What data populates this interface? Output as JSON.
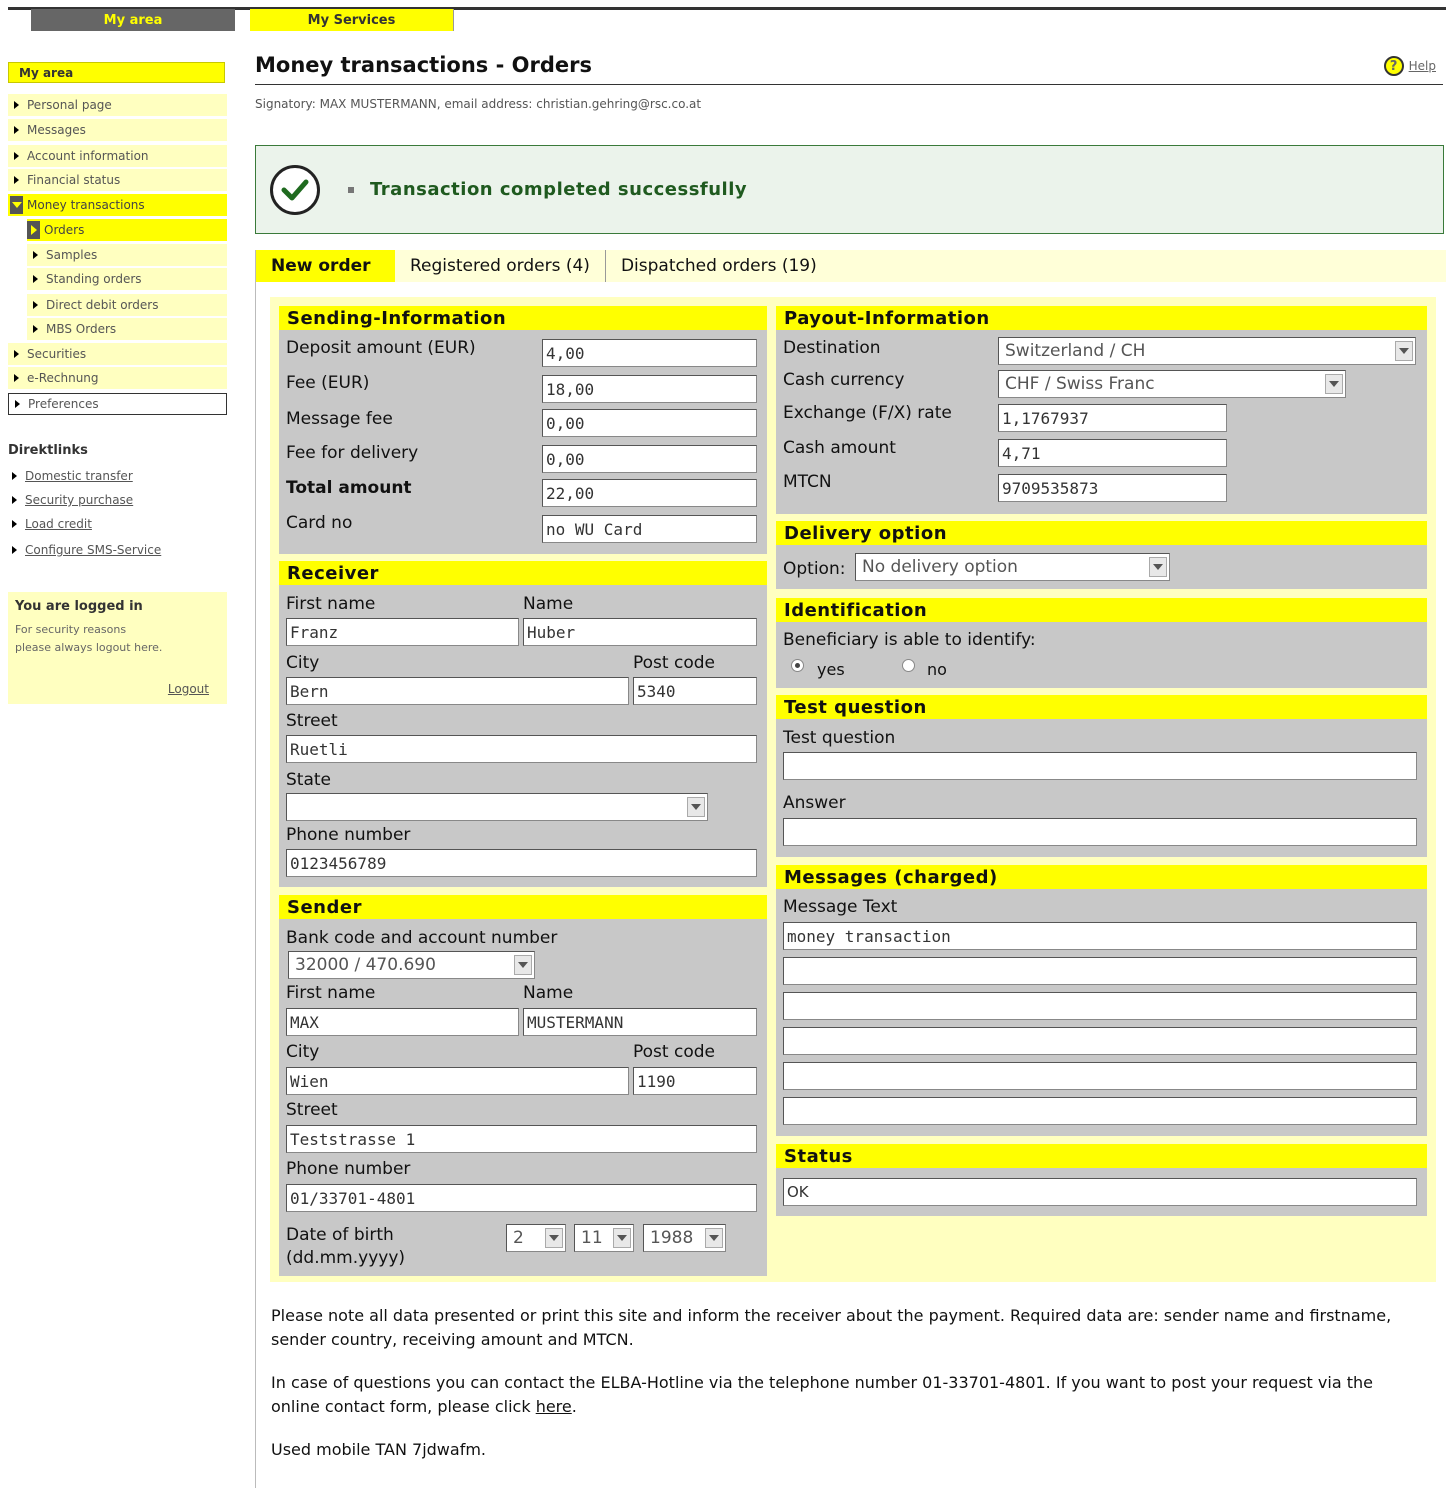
{
  "top_tabs": {
    "my_area": "My area",
    "my_services": "My Services"
  },
  "sidebar": {
    "header": "My area",
    "items": [
      {
        "label": "Personal page"
      },
      {
        "label": "Messages"
      },
      {
        "label": "Account information"
      },
      {
        "label": "Financial status"
      },
      {
        "label": "Money transactions"
      },
      {
        "label": "Orders"
      },
      {
        "label": "Samples"
      },
      {
        "label": "Standing orders"
      },
      {
        "label": "Direct debit orders"
      },
      {
        "label": "MBS Orders"
      },
      {
        "label": "Securities"
      },
      {
        "label": "e-Rechnung"
      },
      {
        "label": "Preferences"
      }
    ],
    "direktlinks_title": "Direktlinks",
    "direktlinks": [
      {
        "label": "Domestic transfer"
      },
      {
        "label": "Security purchase"
      },
      {
        "label": "Load credit"
      },
      {
        "label": "Configure SMS-Service"
      }
    ],
    "logged_title": "You are logged in",
    "logged_text": "For security reasons please always logout here.",
    "logout": "Logout"
  },
  "page": {
    "title": "Money transactions - Orders",
    "help": "Help",
    "signatory": "Signatory: MAX MUSTERMANN, email address: christian.gehring@rsc.co.at",
    "success": "Transaction completed successfully",
    "tabs": [
      "New order",
      "Registered orders (4)",
      "Dispatched orders (19)"
    ]
  },
  "sending": {
    "title": "Sending-Information",
    "deposit_label": "Deposit amount (EUR)",
    "deposit": "4,00",
    "fee_label": "Fee (EUR)",
    "fee": "18,00",
    "msgfee_label": "Message fee",
    "msgfee": "0,00",
    "delivery_label": "Fee for delivery",
    "delivery": "0,00",
    "total_label": "Total amount",
    "total": "22,00",
    "card_label": "Card no",
    "card": "no WU Card"
  },
  "receiver": {
    "title": "Receiver",
    "first_label": "First name",
    "first": "Franz",
    "name_label": "Name",
    "name": "Huber",
    "city_label": "City",
    "city": "Bern",
    "post_label": "Post code",
    "post": "5340",
    "street_label": "Street",
    "street": "Ruetli",
    "state_label": "State",
    "state": "",
    "phone_label": "Phone number",
    "phone": "0123456789"
  },
  "sender": {
    "title": "Sender",
    "bank_label": "Bank code and account number",
    "bank": "32000 / 470.690",
    "first_label": "First name",
    "first": "MAX",
    "name_label": "Name",
    "name": "MUSTERMANN",
    "city_label": "City",
    "city": "Wien",
    "post_label": "Post code",
    "post": "1190",
    "street_label": "Street",
    "street": "Teststrasse 1",
    "phone_label": "Phone number",
    "phone": "01/33701-4801",
    "dob_label": "Date of birth",
    "dob_format": "(dd.mm.yyyy)",
    "dob_day": "2",
    "dob_month": "11",
    "dob_year": "1988"
  },
  "payout": {
    "title": "Payout-Information",
    "dest_label": "Destination",
    "dest": "Switzerland / CH",
    "cur_label": "Cash currency",
    "cur": "CHF / Swiss Franc",
    "fx_label": "Exchange (F/X) rate",
    "fx": "1,1767937",
    "amount_label": "Cash amount",
    "amount": "4,71",
    "mtcn_label": "MTCN",
    "mtcn": "9709535873"
  },
  "delivery": {
    "title": "Delivery option",
    "option_label": "Option:",
    "option": "No delivery option"
  },
  "identification": {
    "title": "Identification",
    "question": "Beneficiary is able to identify:",
    "yes": "yes",
    "no": "no",
    "selected": "yes"
  },
  "test": {
    "title": "Test question",
    "q_label": "Test question",
    "q": "",
    "a_label": "Answer",
    "a": ""
  },
  "messages": {
    "title": "Messages (charged)",
    "label": "Message Text",
    "lines": [
      "money transaction",
      "",
      "",
      "",
      "",
      ""
    ]
  },
  "status": {
    "title": "Status",
    "value": "OK"
  },
  "notes": {
    "p1": "Please note all data presented or print this site and inform the receiver about the payment. Required data are: sender name and firstname, sender country, receiving amount and MTCN.",
    "p2_pre": "In case of questions you can contact the ELBA-Hotline via the telephone number 01-33701-4801. If you want to post your request via the online contact form, please click ",
    "p2_link": "here",
    "p2_post": ".",
    "p3": "Used mobile TAN 7jdwafm."
  },
  "colors": {
    "accent": "#ffff00",
    "panel": "#ffffc0",
    "section": "#c8c8c8",
    "success": "#1f5a1f"
  }
}
